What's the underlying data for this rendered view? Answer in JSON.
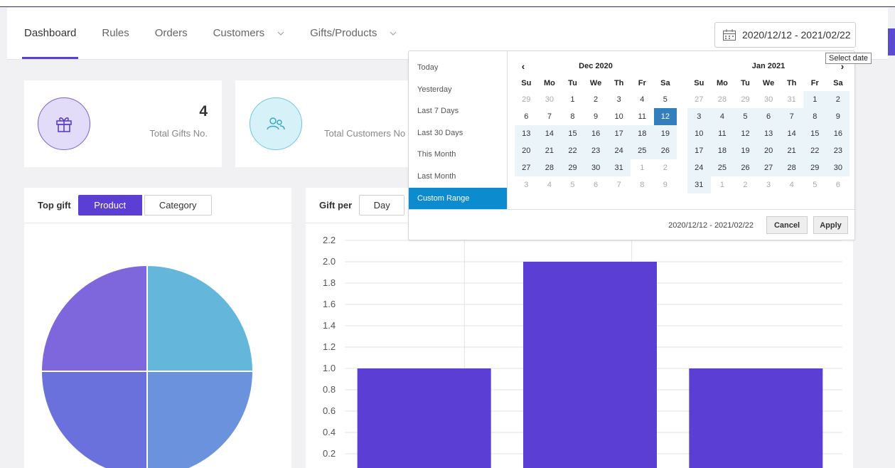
{
  "nav": {
    "items": [
      {
        "label": "Dashboard"
      },
      {
        "label": "Rules"
      },
      {
        "label": "Orders"
      },
      {
        "label": "Customers"
      },
      {
        "label": "Gifts/Products"
      }
    ]
  },
  "date_field": {
    "value": "2020/12/12 - 2021/02/22"
  },
  "tooltip": "Select date",
  "stats": {
    "gifts": {
      "value": "4",
      "label": "Total Gifts No."
    },
    "customers": {
      "label": "Total Customers No"
    }
  },
  "top_gift": {
    "title": "Top gift",
    "tabs": [
      "Product",
      "Category"
    ],
    "active_tab": "Product",
    "colors": [
      "#65b6db",
      "#6b92dc",
      "#6a70dc",
      "#7e66dc"
    ]
  },
  "gift_per": {
    "title": "Gift per",
    "option": "Day"
  },
  "picker": {
    "ranges": [
      "Today",
      "Yesterday",
      "Last 7 Days",
      "Last 30 Days",
      "This Month",
      "Last Month",
      "Custom Range"
    ],
    "active_range": "Custom Range",
    "dow": [
      "Su",
      "Mo",
      "Tu",
      "We",
      "Th",
      "Fr",
      "Sa"
    ],
    "left_month": {
      "title": "Dec 2020",
      "weeks": [
        [
          "29",
          "30",
          "1",
          "2",
          "3",
          "4",
          "5"
        ],
        [
          "6",
          "7",
          "8",
          "9",
          "10",
          "11",
          "12"
        ],
        [
          "13",
          "14",
          "15",
          "16",
          "17",
          "18",
          "19"
        ],
        [
          "20",
          "21",
          "22",
          "23",
          "24",
          "25",
          "26"
        ],
        [
          "27",
          "28",
          "29",
          "30",
          "31",
          "1",
          "2"
        ],
        [
          "3",
          "4",
          "5",
          "6",
          "7",
          "8",
          "9"
        ]
      ]
    },
    "right_month": {
      "title": "Jan 2021",
      "weeks": [
        [
          "27",
          "28",
          "29",
          "30",
          "31",
          "1",
          "2"
        ],
        [
          "3",
          "4",
          "5",
          "6",
          "7",
          "8",
          "9"
        ],
        [
          "10",
          "11",
          "12",
          "13",
          "14",
          "15",
          "16"
        ],
        [
          "17",
          "18",
          "19",
          "20",
          "21",
          "22",
          "23"
        ],
        [
          "24",
          "25",
          "26",
          "27",
          "28",
          "29",
          "30"
        ],
        [
          "31",
          "1",
          "2",
          "3",
          "4",
          "5",
          "6"
        ]
      ]
    },
    "footer_range": "2020/12/12 - 2021/02/22",
    "cancel_label": "Cancel",
    "apply_label": "Apply"
  },
  "chart_data": {
    "type": "bar",
    "categories": [
      "",
      "",
      ""
    ],
    "values": [
      1.0,
      2.0,
      1.0
    ],
    "ylim": [
      0,
      2.2
    ],
    "yticks": [
      "0.2",
      "0.4",
      "0.6",
      "0.8",
      "1.0",
      "1.2",
      "1.4",
      "1.6",
      "1.8",
      "2.0",
      "2.2"
    ],
    "bar_color": "#5b3fd4",
    "grid": true
  }
}
